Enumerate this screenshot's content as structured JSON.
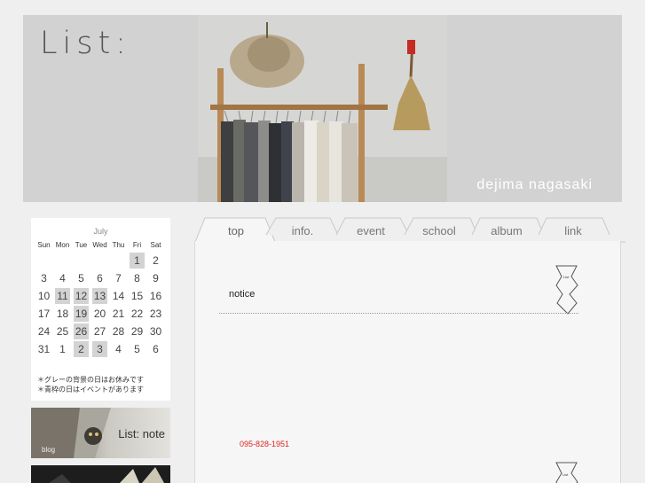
{
  "header": {
    "title": "List:",
    "location": "dejima nagasaki"
  },
  "calendar": {
    "month": "July",
    "weekdays": [
      "Sun",
      "Mon",
      "Tue",
      "Wed",
      "Thu",
      "Fri",
      "Sat"
    ],
    "days": [
      {
        "d": "",
        "h": false
      },
      {
        "d": "",
        "h": false
      },
      {
        "d": "",
        "h": false
      },
      {
        "d": "",
        "h": false
      },
      {
        "d": "",
        "h": false
      },
      {
        "d": "1",
        "h": true
      },
      {
        "d": "2",
        "h": false
      },
      {
        "d": "3",
        "h": false
      },
      {
        "d": "4",
        "h": false
      },
      {
        "d": "5",
        "h": false
      },
      {
        "d": "6",
        "h": false
      },
      {
        "d": "7",
        "h": false
      },
      {
        "d": "8",
        "h": false
      },
      {
        "d": "9",
        "h": false
      },
      {
        "d": "10",
        "h": false
      },
      {
        "d": "11",
        "h": true
      },
      {
        "d": "12",
        "h": true
      },
      {
        "d": "13",
        "h": true
      },
      {
        "d": "14",
        "h": false
      },
      {
        "d": "15",
        "h": false
      },
      {
        "d": "16",
        "h": false
      },
      {
        "d": "17",
        "h": false
      },
      {
        "d": "18",
        "h": false
      },
      {
        "d": "19",
        "h": true
      },
      {
        "d": "20",
        "h": false
      },
      {
        "d": "21",
        "h": false
      },
      {
        "d": "22",
        "h": false
      },
      {
        "d": "23",
        "h": false
      },
      {
        "d": "24",
        "h": false
      },
      {
        "d": "25",
        "h": false
      },
      {
        "d": "26",
        "h": true
      },
      {
        "d": "27",
        "h": false
      },
      {
        "d": "28",
        "h": false
      },
      {
        "d": "29",
        "h": false
      },
      {
        "d": "30",
        "h": false
      },
      {
        "d": "31",
        "h": false
      },
      {
        "d": "1",
        "h": false
      },
      {
        "d": "2",
        "h": true
      },
      {
        "d": "3",
        "h": true
      },
      {
        "d": "4",
        "h": false
      },
      {
        "d": "5",
        "h": false
      },
      {
        "d": "6",
        "h": false
      }
    ],
    "note_line1": "＊グレーの背景の日はお休みです",
    "note_line2": "＊青枠の日はイベントがあります"
  },
  "banners": {
    "note_label": "List: note",
    "note_sub": "blog"
  },
  "tabs": [
    {
      "label": "top",
      "active": true
    },
    {
      "label": "info.",
      "active": false
    },
    {
      "label": "event",
      "active": false
    },
    {
      "label": "school",
      "active": false
    },
    {
      "label": "album",
      "active": false
    },
    {
      "label": "link",
      "active": false
    }
  ],
  "content": {
    "notice_heading": "notice",
    "phone": "095-828-1951",
    "tag_text": "List"
  },
  "colors": {
    "header_bg": "#d2d2d2",
    "holiday_bg": "#d3d3d3",
    "phone_text": "#e0231f"
  }
}
